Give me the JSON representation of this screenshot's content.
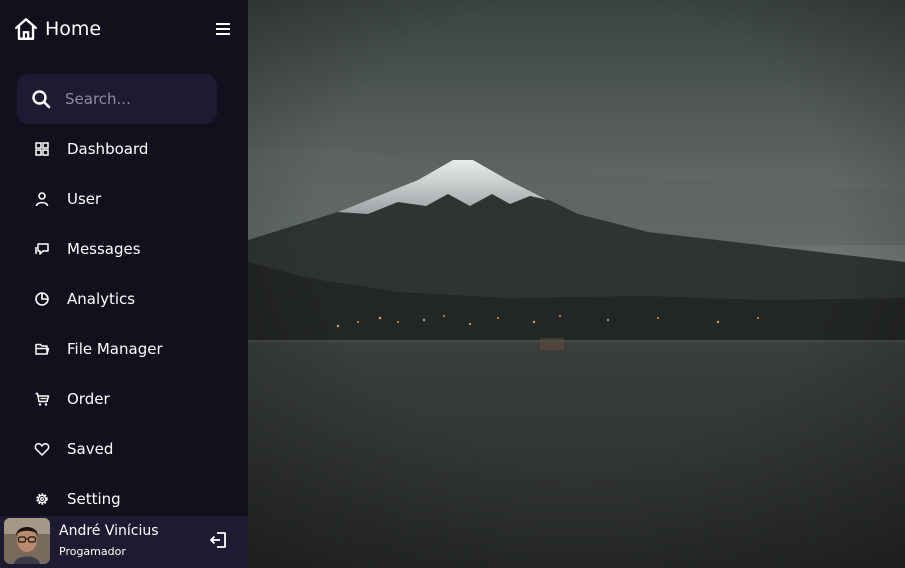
{
  "sidebar": {
    "logo_name": "Home",
    "search": {
      "placeholder": "Search..."
    },
    "items": [
      {
        "label": "Dashboard"
      },
      {
        "label": "User"
      },
      {
        "label": "Messages"
      },
      {
        "label": "Analytics"
      },
      {
        "label": "File Manager"
      },
      {
        "label": "Order"
      },
      {
        "label": "Saved"
      },
      {
        "label": "Setting"
      }
    ],
    "profile": {
      "name": "André Vinícius",
      "job": "Progamador"
    }
  },
  "colors": {
    "sidebar_bg": "#11101d",
    "search_bg": "#1d1b31",
    "text": "#ffffff"
  },
  "icons": [
    "home-icon",
    "menu-icon",
    "search-icon",
    "grid-icon",
    "user-icon",
    "chat-icon",
    "pie-chart-icon",
    "folder-icon",
    "cart-icon",
    "heart-icon",
    "cog-icon",
    "logout-icon"
  ]
}
